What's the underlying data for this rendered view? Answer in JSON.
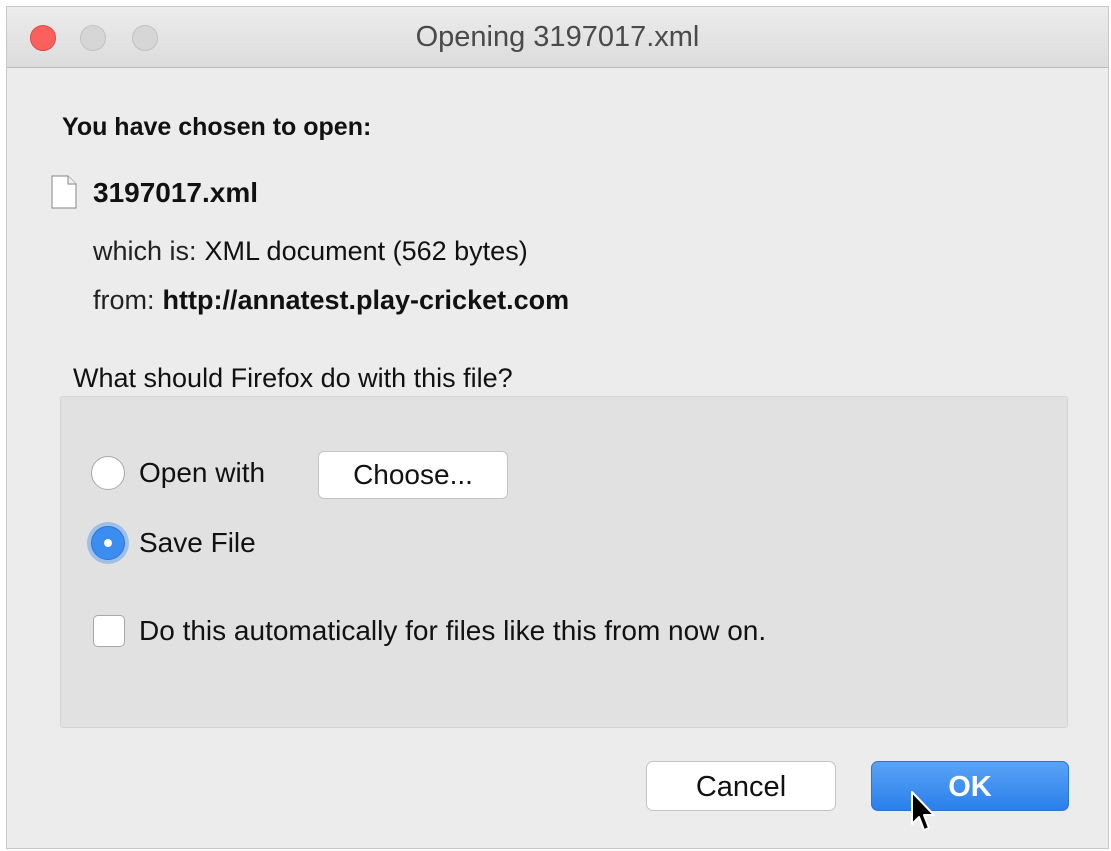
{
  "window": {
    "title": "Opening 3197017.xml"
  },
  "dialog": {
    "heading": "You have chosen to open:",
    "file_name": "3197017.xml",
    "which_is_label": "which is:",
    "which_is_value": "XML document (562 bytes)",
    "from_label": "from:",
    "from_value": "http://annatest.play-cricket.com",
    "question": "What should Firefox do with this file?"
  },
  "options": {
    "open_with_label": "Open with",
    "choose_button": "Choose...",
    "save_file_label": "Save File",
    "selected": "Save File",
    "auto_label": "Do this automatically for files like this from now on.",
    "auto_checked": false
  },
  "buttons": {
    "cancel": "Cancel",
    "ok": "OK"
  },
  "colors": {
    "accent": "#3b8df0",
    "close_button": "#fc605c"
  },
  "icons": {
    "file": "document-icon",
    "cursor": "mouse-pointer-icon"
  }
}
